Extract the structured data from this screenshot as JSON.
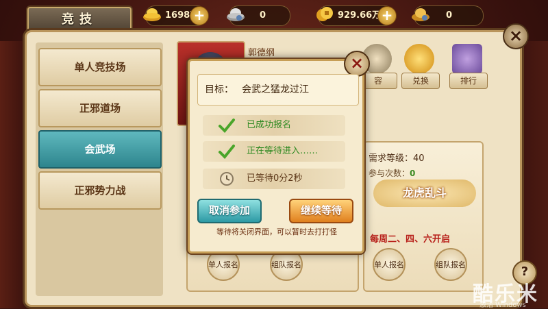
{
  "header": {
    "title": "竞技"
  },
  "resources": [
    {
      "name": "gold-ingot",
      "value": "169876",
      "color": "#f0c040"
    },
    {
      "name": "silver-ingot",
      "value": "0",
      "color": "#c9c9c9"
    },
    {
      "name": "coins",
      "value": "929.66万",
      "color": "#f0b020"
    },
    {
      "name": "voucher",
      "value": "0",
      "color": "#e8b850"
    }
  ],
  "menu": {
    "items": [
      {
        "label": "单人竞技场",
        "active": false
      },
      {
        "label": "正邪道场",
        "active": false
      },
      {
        "label": "会武场",
        "active": true
      },
      {
        "label": "正邪势力战",
        "active": false
      }
    ]
  },
  "player": {
    "name": "郭德纲"
  },
  "icon_buttons": [
    {
      "label": "容",
      "icon": "lineup-icon"
    },
    {
      "label": "兑换",
      "icon": "exchange-icon"
    },
    {
      "label": "排行",
      "icon": "ranking-icon"
    }
  ],
  "event_card": {
    "required_level": "需求等级：40",
    "participation_label": "参与次数：",
    "participation_value": "0",
    "name": "龙虎乱斗",
    "schedule": "每周二、四、六开启",
    "solo_button": "单人报名",
    "team_button": "组队报名"
  },
  "left_card": {
    "solo_button": "单人报名",
    "team_button": "组队报名"
  },
  "dialog": {
    "goal_key": "目标：",
    "goal_value": "会武之猛龙过江",
    "status_rows": [
      {
        "icon": "checkmark-icon",
        "text": "已成功报名"
      },
      {
        "icon": "checkmark-icon",
        "text": "正在等待进入……"
      },
      {
        "icon": "clock-icon",
        "text": "已等待0分2秒"
      }
    ],
    "cancel_button": "取消参加",
    "continue_button": "继续等待",
    "tip": "等待将关闭界面，可以暂时去打打怪"
  },
  "watermark": {
    "text": "酷乐米",
    "sub": "激活 Windows"
  }
}
